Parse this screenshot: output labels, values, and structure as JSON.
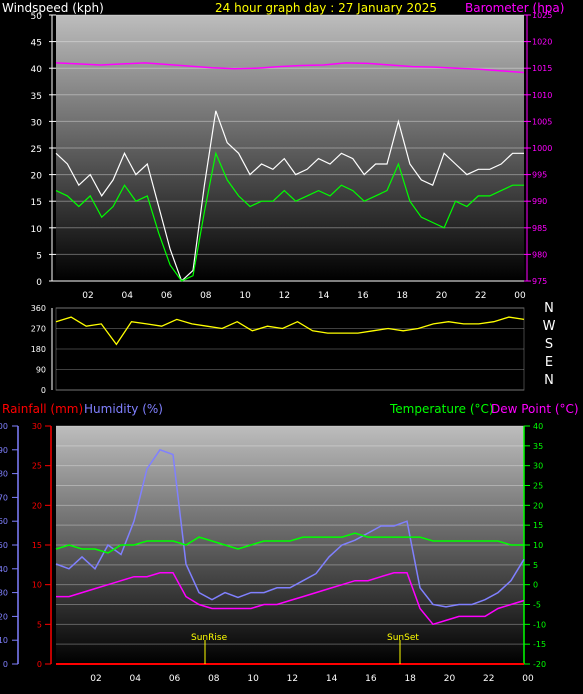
{
  "header": {
    "title": "24 hour graph day : 27 January 2025",
    "wind_label": "Windspeed (kph)",
    "baro_label": "Barometer (hpa)",
    "rain_label": "Rainfall (mm)",
    "hum_label": "Humidity (%)",
    "temp_label": "Temperature (°C)",
    "dew_label": "Dew Point (°C)",
    "sunrise_label": "SunRise",
    "sunset_label": "SunSet"
  },
  "colors": {
    "title": "#ffff00",
    "baro": "#ff00ff",
    "rain": "#ff0000",
    "humidity": "#8080ff",
    "temp": "#00ff00",
    "dew": "#ff00ff",
    "wind_gust": "#ffffff",
    "wind_avg": "#00ff00",
    "wind_dir": "#ffff00",
    "sun_marker": "#ffff00"
  },
  "compass": [
    "N",
    "W",
    "S",
    "E",
    "N"
  ],
  "chart_data": [
    {
      "type": "line",
      "name": "wind_baro",
      "x_ticks": [
        "02",
        "04",
        "06",
        "08",
        "10",
        "12",
        "14",
        "16",
        "18",
        "20",
        "22",
        "00"
      ],
      "y_ticks_left": [
        0,
        5,
        10,
        15,
        20,
        25,
        30,
        35,
        40,
        45,
        50
      ],
      "ylim_left": [
        0,
        50
      ],
      "y_ticks_right": [
        975,
        980,
        985,
        990,
        995,
        1000,
        1005,
        1010,
        1015,
        1020,
        1025
      ],
      "ylim_right": [
        975,
        1025
      ],
      "series": [
        {
          "name": "Windspeed gust",
          "axis": "left",
          "values": [
            24,
            22,
            18,
            20,
            16,
            19,
            24,
            20,
            22,
            14,
            6,
            0,
            2,
            18,
            32,
            26,
            24,
            20,
            22,
            21,
            23,
            20,
            21,
            23,
            22,
            24,
            23,
            20,
            22,
            22,
            30,
            22,
            19,
            18,
            24,
            22,
            20,
            21,
            21,
            22,
            24,
            24
          ]
        },
        {
          "name": "Windspeed avg",
          "axis": "left",
          "values": [
            17,
            16,
            14,
            16,
            12,
            14,
            18,
            15,
            16,
            9,
            3,
            0,
            1,
            13,
            24,
            19,
            16,
            14,
            15,
            15,
            17,
            15,
            16,
            17,
            16,
            18,
            17,
            15,
            16,
            17,
            22,
            15,
            12,
            11,
            10,
            15,
            14,
            16,
            16,
            17,
            18,
            18
          ]
        },
        {
          "name": "Barometer (hpa)",
          "axis": "right",
          "values": [
            1016.0,
            1015.8,
            1015.6,
            1015.8,
            1016.0,
            1015.7,
            1015.4,
            1015.1,
            1014.9,
            1015.0,
            1015.3,
            1015.5,
            1015.6,
            1016.0,
            1015.9,
            1015.6,
            1015.3,
            1015.2,
            1015.0,
            1014.8,
            1014.5,
            1014.2
          ]
        }
      ]
    },
    {
      "type": "line",
      "name": "wind_direction",
      "y_ticks_left": [
        0,
        90,
        180,
        270,
        360
      ],
      "ylim": [
        0,
        360
      ],
      "series": [
        {
          "name": "Wind direction",
          "values": [
            300,
            320,
            280,
            290,
            200,
            300,
            290,
            280,
            310,
            290,
            280,
            270,
            300,
            260,
            280,
            270,
            300,
            260,
            250,
            250,
            250,
            260,
            270,
            260,
            270,
            290,
            300,
            290,
            290,
            300,
            320,
            310
          ]
        }
      ]
    },
    {
      "type": "line",
      "name": "temp_hum_rain",
      "y_ticks_hum": [
        0,
        10,
        20,
        30,
        40,
        50,
        60,
        70,
        80,
        90,
        100
      ],
      "ylim_hum": [
        0,
        100
      ],
      "y_ticks_rain": [
        0,
        5,
        10,
        15,
        20,
        25,
        30
      ],
      "ylim_rain": [
        0,
        30
      ],
      "y_ticks_temp": [
        -20,
        -15,
        -10,
        -5,
        0,
        5,
        10,
        15,
        20,
        25,
        30,
        35,
        40
      ],
      "ylim_temp": [
        -20,
        40
      ],
      "series": [
        {
          "name": "Humidity (%)",
          "axis": "hum",
          "values": [
            42,
            40,
            45,
            40,
            50,
            46,
            60,
            82,
            90,
            88,
            42,
            30,
            27,
            30,
            28,
            30,
            30,
            32,
            32,
            35,
            38,
            45,
            50,
            52,
            55,
            58,
            58,
            60,
            32,
            25,
            24,
            25,
            25,
            27,
            30,
            35,
            44
          ]
        },
        {
          "name": "Temperature (°C)",
          "axis": "temp",
          "values": [
            9,
            10,
            9,
            9,
            8,
            10,
            10,
            11,
            11,
            11,
            10,
            12,
            11,
            10,
            9,
            10,
            11,
            11,
            11,
            12,
            12,
            12,
            12,
            13,
            12,
            12,
            12,
            12,
            12,
            11,
            11,
            11,
            11,
            11,
            11,
            10,
            10
          ]
        },
        {
          "name": "Dew Point (°C)",
          "axis": "temp",
          "values": [
            -3,
            -3,
            -2,
            -1,
            0,
            1,
            2,
            2,
            3,
            3,
            -3,
            -5,
            -6,
            -6,
            -6,
            -6,
            -5,
            -5,
            -4,
            -3,
            -2,
            -1,
            0,
            1,
            1,
            2,
            3,
            3,
            -6,
            -10,
            -9,
            -8,
            -8,
            -8,
            -6,
            -5,
            -4
          ]
        },
        {
          "name": "Rainfall (mm)",
          "axis": "rain",
          "values": [
            0,
            0,
            0,
            0,
            0,
            0,
            0,
            0,
            0,
            0,
            0,
            0,
            0
          ]
        }
      ]
    }
  ]
}
